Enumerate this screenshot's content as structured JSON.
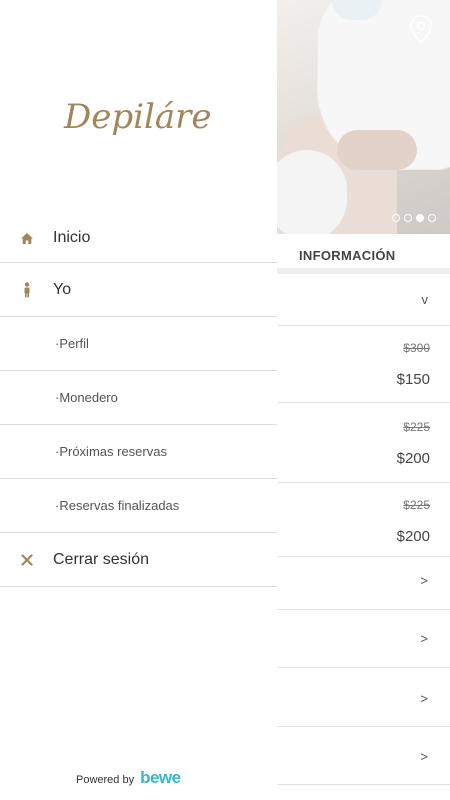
{
  "brand": {
    "logo_text": "Depiláre",
    "accent_color": "#a0875a"
  },
  "menu": {
    "items": [
      {
        "label": "Inicio",
        "icon": "home-icon"
      },
      {
        "label": "Yo",
        "icon": "person-icon"
      },
      {
        "label": "·Perfil"
      },
      {
        "label": "·Monedero"
      },
      {
        "label": "·Próximas reservas"
      },
      {
        "label": "·Reservas finalizadas"
      },
      {
        "label": "Cerrar sesión",
        "icon": "close-icon"
      }
    ]
  },
  "footer": {
    "powered_by": "Powered by",
    "brand": "bewe",
    "brand_color": "#3ab7c4"
  },
  "background": {
    "section_title": "INFORMACIÓN",
    "carousel": {
      "total_dots": 4,
      "active_dot": 3
    },
    "rows": [
      {
        "chevron": "v"
      },
      {
        "old_price": "$300",
        "new_price": "$150"
      },
      {
        "old_price": "$225",
        "new_price": "$200"
      },
      {
        "old_price": "$225",
        "new_price": "$200"
      },
      {
        "chevron": ">"
      },
      {
        "chevron": ">"
      },
      {
        "chevron": ">"
      },
      {
        "chevron": ">"
      }
    ]
  }
}
